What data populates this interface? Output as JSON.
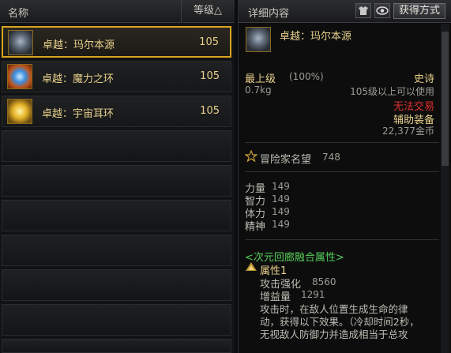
{
  "list": {
    "header_name": "名称",
    "header_sort": "等级△",
    "items": [
      {
        "label": "卓越：玛尔本源",
        "level": "105"
      },
      {
        "label": "卓越：魔力之环",
        "level": "105"
      },
      {
        "label": "卓越：宇宙耳环",
        "level": "105"
      }
    ]
  },
  "detail": {
    "header_title": "详细内容",
    "acquire_button": "获得方式",
    "item_name": "卓越：玛尔本源",
    "grade": "最上级",
    "grade_pct": "(100%)",
    "rarity": "史诗",
    "weight": "0.7kg",
    "level_req": "105级以上可以使用",
    "trade": "无法交易",
    "type": "辅助装备",
    "price": "22,377金币",
    "fame_label": "冒险家名望",
    "fame_value": "748",
    "stats": [
      {
        "name": "力量",
        "value": "149"
      },
      {
        "name": "智力",
        "value": "149"
      },
      {
        "name": "体力",
        "value": "149"
      },
      {
        "name": "精神",
        "value": "149"
      }
    ],
    "fusion_title": "<次元回廊融合属性>",
    "attr_label": "属性1",
    "attack_boost_label": "攻击强化",
    "attack_boost_value": "8560",
    "gain_label": "增益量",
    "gain_value": "1291",
    "effect_line1": "攻击时，在敌人位置生成生命的律",
    "effect_line2": "动，获得以下效果。（冷却时间2秒，",
    "effect_line3": "无视敌人防御力并造成相当于总攻"
  },
  "colors": {
    "gold": "#e7d08a",
    "select_border": "#d9a520",
    "red": "#e02f2f",
    "green": "#57d05a"
  }
}
